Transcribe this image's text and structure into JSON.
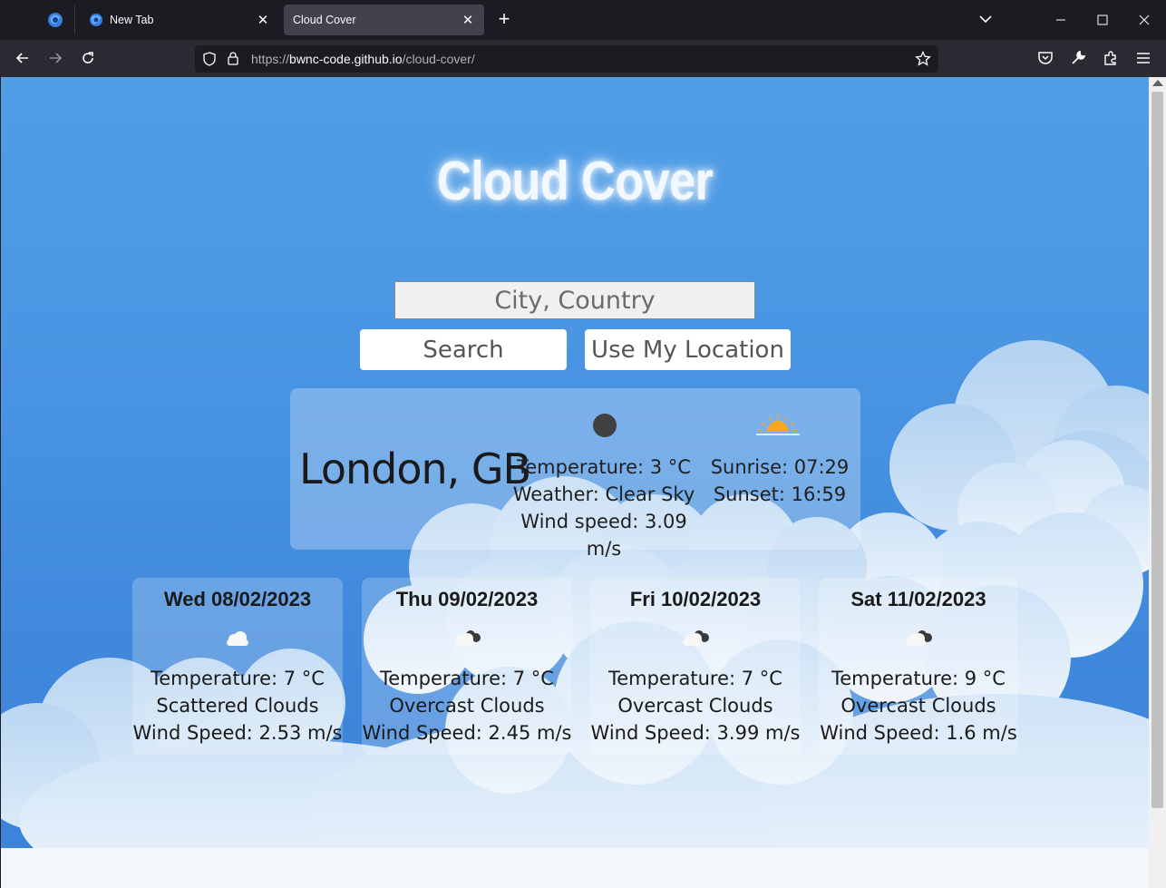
{
  "browser": {
    "tabs": [
      {
        "label": "New Tab",
        "active": false
      },
      {
        "label": "Cloud Cover",
        "active": true
      }
    ],
    "url_host": "bwnc-code.github.io",
    "url_prefix": "https://",
    "url_path": "/cloud-cover/"
  },
  "page": {
    "title": "Cloud Cover",
    "search_placeholder": "City, Country",
    "search_button": "Search",
    "location_button": "Use My Location"
  },
  "current": {
    "city": "London, GB",
    "temperature": "Temperature: 3 °C",
    "weather": "Weather: Clear Sky",
    "wind": "Wind speed: 3.09 m/s",
    "sunrise": "Sunrise: 07:29",
    "sunset": "Sunset: 16:59",
    "icon": "dark-moon-icon"
  },
  "forecast": [
    {
      "date": "Wed 08/02/2023",
      "icon": "scattered-clouds-icon",
      "temperature": "Temperature: 7 °C",
      "desc": "Scattered Clouds",
      "wind": "Wind Speed: 2.53 m/s"
    },
    {
      "date": "Thu 09/02/2023",
      "icon": "overcast-clouds-icon",
      "temperature": "Temperature: 7 °C",
      "desc": "Overcast Clouds",
      "wind": "Wind Speed: 2.45 m/s"
    },
    {
      "date": "Fri 10/02/2023",
      "icon": "overcast-clouds-icon",
      "temperature": "Temperature: 7 °C",
      "desc": "Overcast Clouds",
      "wind": "Wind Speed: 3.99 m/s"
    },
    {
      "date": "Sat 11/02/2023",
      "icon": "overcast-clouds-icon",
      "temperature": "Temperature: 9 °C",
      "desc": "Overcast Clouds",
      "wind": "Wind Speed: 1.6 m/s"
    }
  ],
  "colors": {
    "sky": "#4a95e3",
    "browser_bg": "#1c1b22",
    "sun": "#f5a623"
  }
}
